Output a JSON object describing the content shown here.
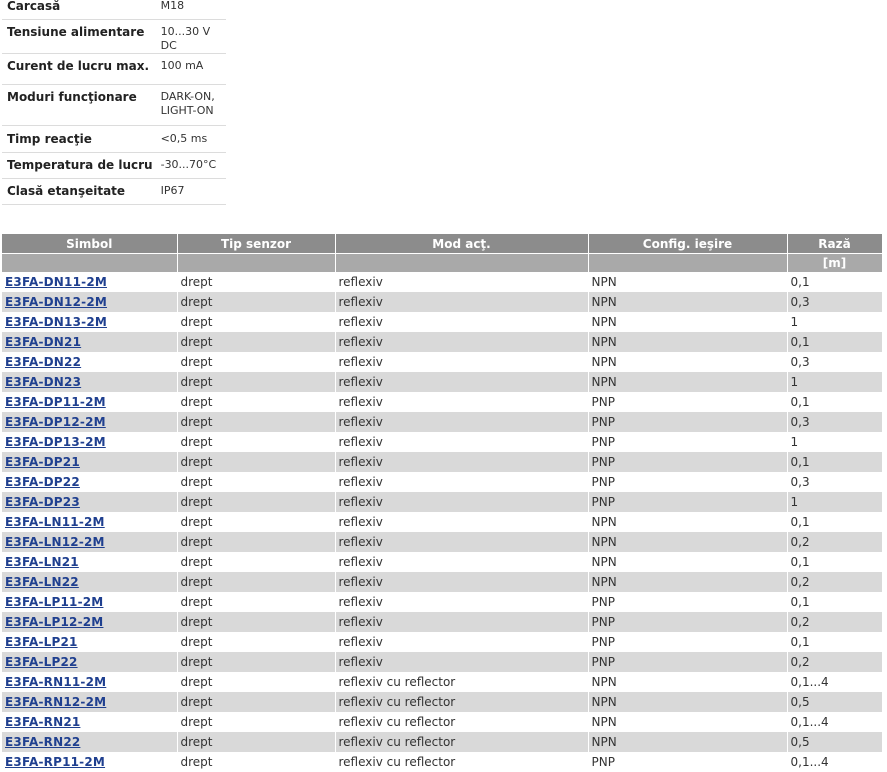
{
  "specs": [
    {
      "label": "Carcasă",
      "value": "M18"
    },
    {
      "label": "Tensiune alimentare",
      "value": "10...30 V DC"
    },
    {
      "label": "Curent de lucru max.",
      "value": "100 mA"
    },
    {
      "label": "Moduri funcţionare",
      "value": "DARK-ON,\nLIGHT-ON"
    },
    {
      "label": "Timp reacţie",
      "value": "<0,5 ms"
    },
    {
      "label": "Temperatura de lucru",
      "value": "-30...70°C"
    },
    {
      "label": "Clasă etanşeitate",
      "value": "IP67"
    }
  ],
  "table": {
    "headers": [
      "Simbol",
      "Tip senzor",
      "Mod acţ.",
      "Config. ieşire",
      "Rază"
    ],
    "units": [
      "",
      "",
      "",
      "",
      "[m]"
    ],
    "rows": [
      [
        "E3FA-DN11-2M",
        "drept",
        "reflexiv",
        "NPN",
        "0,1"
      ],
      [
        "E3FA-DN12-2M",
        "drept",
        "reflexiv",
        "NPN",
        "0,3"
      ],
      [
        "E3FA-DN13-2M",
        "drept",
        "reflexiv",
        "NPN",
        "1"
      ],
      [
        "E3FA-DN21",
        "drept",
        "reflexiv",
        "NPN",
        "0,1"
      ],
      [
        "E3FA-DN22",
        "drept",
        "reflexiv",
        "NPN",
        "0,3"
      ],
      [
        "E3FA-DN23",
        "drept",
        "reflexiv",
        "NPN",
        "1"
      ],
      [
        "E3FA-DP11-2M",
        "drept",
        "reflexiv",
        "PNP",
        "0,1"
      ],
      [
        "E3FA-DP12-2M",
        "drept",
        "reflexiv",
        "PNP",
        "0,3"
      ],
      [
        "E3FA-DP13-2M",
        "drept",
        "reflexiv",
        "PNP",
        "1"
      ],
      [
        "E3FA-DP21",
        "drept",
        "reflexiv",
        "PNP",
        "0,1"
      ],
      [
        "E3FA-DP22",
        "drept",
        "reflexiv",
        "PNP",
        "0,3"
      ],
      [
        "E3FA-DP23",
        "drept",
        "reflexiv",
        "PNP",
        "1"
      ],
      [
        "E3FA-LN11-2M",
        "drept",
        "reflexiv",
        "NPN",
        "0,1"
      ],
      [
        "E3FA-LN12-2M",
        "drept",
        "reflexiv",
        "NPN",
        "0,2"
      ],
      [
        "E3FA-LN21",
        "drept",
        "reflexiv",
        "NPN",
        "0,1"
      ],
      [
        "E3FA-LN22",
        "drept",
        "reflexiv",
        "NPN",
        "0,2"
      ],
      [
        "E3FA-LP11-2M",
        "drept",
        "reflexiv",
        "PNP",
        "0,1"
      ],
      [
        "E3FA-LP12-2M",
        "drept",
        "reflexiv",
        "PNP",
        "0,2"
      ],
      [
        "E3FA-LP21",
        "drept",
        "reflexiv",
        "PNP",
        "0,1"
      ],
      [
        "E3FA-LP22",
        "drept",
        "reflexiv",
        "PNP",
        "0,2"
      ],
      [
        "E3FA-RN11-2M",
        "drept",
        "reflexiv cu reflector",
        "NPN",
        "0,1...4"
      ],
      [
        "E3FA-RN12-2M",
        "drept",
        "reflexiv cu reflector",
        "NPN",
        "0,5"
      ],
      [
        "E3FA-RN21",
        "drept",
        "reflexiv cu reflector",
        "NPN",
        "0,1...4"
      ],
      [
        "E3FA-RN22",
        "drept",
        "reflexiv cu reflector",
        "NPN",
        "0,5"
      ],
      [
        "E3FA-RP11-2M",
        "drept",
        "reflexiv cu reflector",
        "PNP",
        "0,1...4"
      ]
    ]
  },
  "colors": {
    "header_bg": "#8c8c8c",
    "units_bg": "#a9a9a9",
    "row_alt_bg": "#d9d9d9",
    "link": "#1f3f8f"
  }
}
